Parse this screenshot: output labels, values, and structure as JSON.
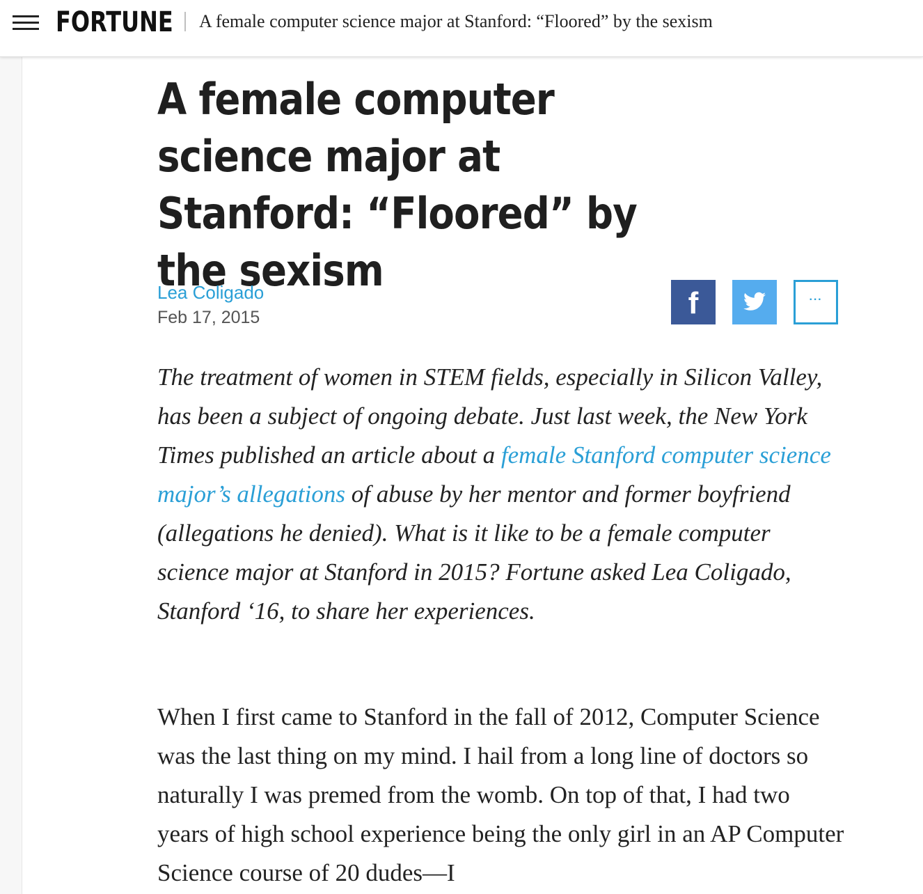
{
  "header": {
    "logo": "FORTUNE",
    "title": "A female computer science major at Stanford: “Floored” by the sexism"
  },
  "article": {
    "headline": "A female computer science major at Stanford: “Floored” by the sexism",
    "author": "Lea Coligado",
    "date": "Feb 17, 2015",
    "share": {
      "facebook_icon": "facebook-icon",
      "twitter_icon": "twitter-icon",
      "more_label": "···",
      "colors": {
        "facebook": "#3b5998",
        "twitter": "#55acee",
        "accent": "#2a9fd6"
      }
    },
    "intro": {
      "before_link": "The treatment of women in STEM fields, especially in Silicon Valley, has been a subject of ongoing debate. Just last week, the New York Times published an article about a ",
      "link_text": "female Stanford computer science major’s allegations",
      "after_link": " of abuse by her mentor and former boyfriend (allegations he denied). What is it like to be a female computer science major at Stanford in 2015? Fortune asked Lea Coligado, Stanford ‘16, to share her experiences."
    },
    "first_paragraph": "When I first came to Stanford in the fall of 2012, Computer Science was the last thing on my mind. I hail from a long line of doctors so naturally I was premed from the womb. On top of that, I had two years of high school experience being the only girl in an AP Computer Science course of 20 dudes—I"
  }
}
